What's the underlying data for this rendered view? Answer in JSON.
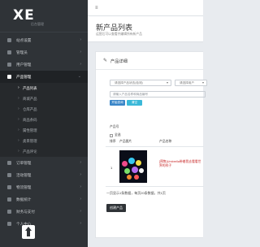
{
  "brand": {
    "logo": "XE",
    "subtitle": "后台管理"
  },
  "sidebar": {
    "items": [
      {
        "label": "站点设置",
        "active": false
      },
      {
        "label": "管理员",
        "active": false
      },
      {
        "label": "用户管理",
        "active": false
      },
      {
        "label": "产品管理",
        "active": true
      },
      {
        "label": "订单管理",
        "active": false
      },
      {
        "label": "活动管理",
        "active": false
      },
      {
        "label": "物流管理",
        "active": false
      },
      {
        "label": "数据统计",
        "active": false
      },
      {
        "label": "财务与支付",
        "active": false
      },
      {
        "label": "个人中心",
        "active": false
      }
    ],
    "subitems": [
      {
        "label": "产品列表",
        "current": true
      },
      {
        "label": "商城产品",
        "current": false
      },
      {
        "label": "仓库产品",
        "current": false
      },
      {
        "label": "商品条码",
        "current": false
      },
      {
        "label": "属性管理",
        "current": false
      },
      {
        "label": "类目管理",
        "current": false
      },
      {
        "label": "产品评论",
        "current": false
      }
    ]
  },
  "header": {
    "menu_icon": "≡"
  },
  "page": {
    "title": "新产品列表",
    "description": "运营后可以查看并编辑所有新产品"
  },
  "panel": {
    "title": "产品详细",
    "filter": {
      "select1": "请选择产品状态(检测)",
      "select2": "请选择用户",
      "search_placeholder": "请输入产品名称和商品编号",
      "submit": "开始查询",
      "reset": "清空"
    },
    "table": {
      "col_id": "产品号",
      "check_all": "全选",
      "col_sort": "排序",
      "col_image": "产品图片",
      "col_name": "产品名称",
      "rows": [
        {
          "id": "1",
          "name": "[预售]Umbrella带着我去看看世界的样子"
        }
      ]
    },
    "pager": "一页显示1条数据，每页20条数据，共1页",
    "create_button": "创建产品"
  }
}
